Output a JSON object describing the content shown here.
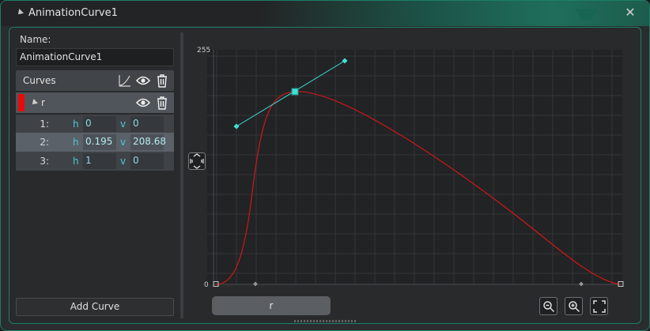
{
  "window": {
    "title": "AnimationCurve1",
    "close_glyph": "✕"
  },
  "name": {
    "label": "Name:",
    "value": "AnimationCurve1"
  },
  "curves": {
    "header": "Curves",
    "items": [
      {
        "name": "r",
        "color": "#e80b0b",
        "points": [
          {
            "index": "1:",
            "h_label": "h",
            "h": "0",
            "v_label": "v",
            "v": "0"
          },
          {
            "index": "2:",
            "h_label": "h",
            "h": "0.195",
            "v_label": "v",
            "v": "208.68"
          },
          {
            "index": "3:",
            "h_label": "h",
            "h": "1",
            "v_label": "v",
            "v": "0"
          }
        ]
      }
    ]
  },
  "add_curve_label": "Add Curve",
  "graph": {
    "y_top_label": "255",
    "y_bottom_label": "0",
    "curve_color": "#d01717",
    "tangent_color": "#3fe0d6",
    "grid_color": "#353639",
    "background": "#222325"
  },
  "curve_tab_label": "r",
  "icons": [
    "collapse-arrow-icon",
    "close-icon",
    "curve-icon",
    "eye-icon",
    "trash-icon",
    "fit-vertical-icon",
    "zoom-out-icon",
    "zoom-in-icon",
    "fit-all-icon"
  ]
}
